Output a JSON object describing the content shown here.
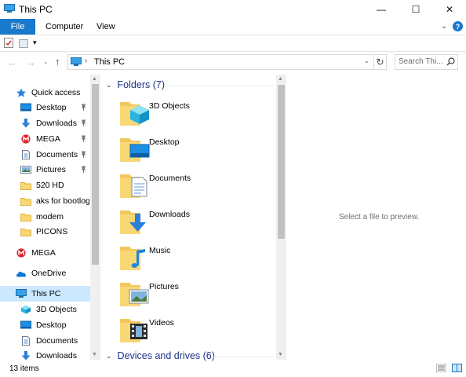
{
  "window": {
    "title": "This PC",
    "controls": {
      "minimize": "—",
      "maximize": "☐",
      "close": "✕"
    }
  },
  "ribbon": {
    "tabs": [
      {
        "label": "File",
        "active": true
      },
      {
        "label": "Computer"
      },
      {
        "label": "View"
      }
    ],
    "accent": "#1979ca",
    "help_label": "?",
    "collapse_glyph": "⌄"
  },
  "qat": {
    "dropdown_glyph": "▾"
  },
  "address": {
    "back_glyph": "←",
    "forward_glyph": "→",
    "recent_glyph": "⌄",
    "up_glyph": "↑",
    "separator": "›",
    "path": "This PC",
    "dropdown_glyph": "⌄",
    "refresh_glyph": "↻",
    "search_placeholder": "Search Thi..."
  },
  "nav_pane": {
    "items": [
      {
        "label": "Quick access",
        "icon": "star-icon",
        "indent": 0
      },
      {
        "label": "Desktop",
        "icon": "desktop-icon",
        "indent": 1,
        "pinned": true
      },
      {
        "label": "Downloads",
        "icon": "download-icon",
        "indent": 1,
        "pinned": true
      },
      {
        "label": "MEGA",
        "icon": "mega-icon",
        "indent": 1,
        "pinned": true
      },
      {
        "label": "Documents",
        "icon": "document-icon",
        "indent": 1,
        "pinned": true
      },
      {
        "label": "Pictures",
        "icon": "pictures-icon",
        "indent": 1,
        "pinned": true
      },
      {
        "label": "520 HD",
        "icon": "folder-icon",
        "indent": 1
      },
      {
        "label": "aks for bootlogo",
        "icon": "folder-icon",
        "indent": 1
      },
      {
        "label": "modem",
        "icon": "folder-icon",
        "indent": 1
      },
      {
        "label": "PICONS",
        "icon": "folder-icon",
        "indent": 1
      },
      {
        "label": "MEGA",
        "icon": "mega-icon",
        "indent": 0
      },
      {
        "label": "OneDrive",
        "icon": "onedrive-icon",
        "indent": 0
      },
      {
        "label": "This PC",
        "icon": "pc-icon",
        "indent": 0,
        "selected": true
      },
      {
        "label": "3D Objects",
        "icon": "cube-icon",
        "indent": 1
      },
      {
        "label": "Desktop",
        "icon": "desktop-icon",
        "indent": 1
      },
      {
        "label": "Documents",
        "icon": "document-icon",
        "indent": 1
      },
      {
        "label": "Downloads",
        "icon": "download-icon",
        "indent": 1
      }
    ],
    "pin_glyph": "📌",
    "selected_bg": "#cce8ff"
  },
  "content": {
    "groups": [
      {
        "title": "Folders (7)",
        "chevron": "⌄",
        "items": [
          {
            "label": "3D Objects",
            "icon": "cube-icon"
          },
          {
            "label": "Desktop",
            "icon": "desktop-icon"
          },
          {
            "label": "Documents",
            "icon": "document-icon"
          },
          {
            "label": "Downloads",
            "icon": "download-icon"
          },
          {
            "label": "Music",
            "icon": "music-icon"
          },
          {
            "label": "Pictures",
            "icon": "pictures-icon"
          },
          {
            "label": "Videos",
            "icon": "videos-icon"
          }
        ]
      },
      {
        "title": "Devices and drives (6)",
        "chevron": "⌄"
      }
    ],
    "group_color": "#1e3287",
    "scroll_up": "▲",
    "scroll_down": "▼"
  },
  "preview": {
    "text": "Select a file to preview."
  },
  "status": {
    "count": "13 items"
  }
}
